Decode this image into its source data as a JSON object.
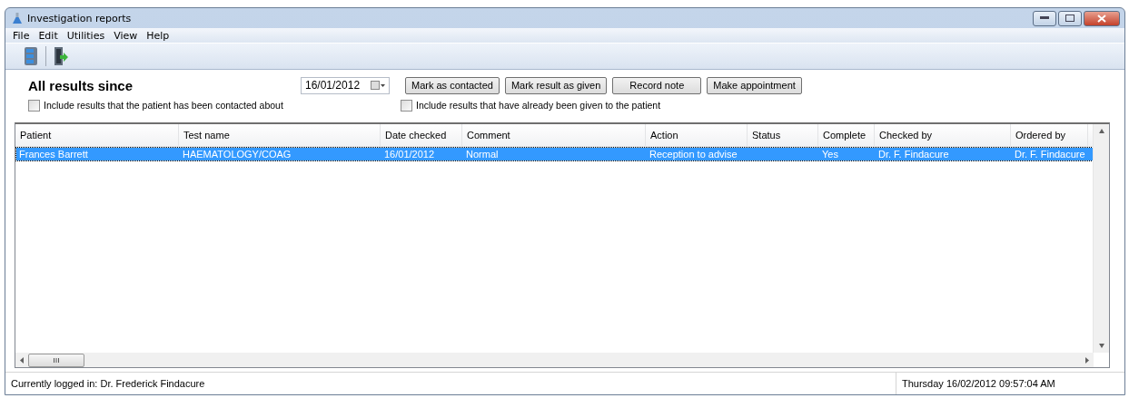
{
  "window": {
    "title": "Investigation reports"
  },
  "menu": [
    "File",
    "Edit",
    "Utilities",
    "View",
    "Help"
  ],
  "filter": {
    "heading": "All results since",
    "date": "16/01/2012",
    "buttons": [
      "Mark as contacted",
      "Mark result as given",
      "Record note",
      "Make appointment"
    ],
    "options": [
      {
        "label": "Include results that the patient has been contacted about",
        "checked": false
      },
      {
        "label": "Include results that have already been given to the patient",
        "checked": false
      }
    ]
  },
  "table": {
    "columns": [
      "Patient",
      "Test name",
      "Date checked",
      "Comment",
      "Action",
      "Status",
      "Complete",
      "Checked by",
      "Ordered by"
    ],
    "rows": [
      {
        "selected": true,
        "cells": [
          "Frances Barrett",
          "HAEMATOLOGY/COAG",
          "16/01/2012",
          "Normal",
          "Reception to advise",
          "",
          "Yes",
          "Dr. F. Findacure",
          "Dr. F. Findacure"
        ]
      }
    ]
  },
  "status_bar": {
    "user": "Currently logged in:  Dr. Frederick Findacure",
    "datetime": "Thursday 16/02/2012 09:57:04 AM"
  }
}
